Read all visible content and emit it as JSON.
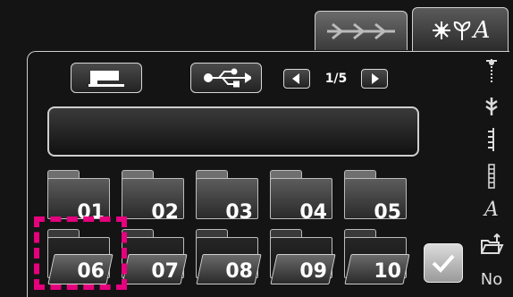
{
  "tabs": {
    "stitch_tab": {
      "icon": "decorative-stitch-icon"
    },
    "letter_tab": {
      "label": "A",
      "icons": [
        "flower-icon",
        "leaf-icon"
      ]
    }
  },
  "toolbar": {
    "machine_icon": "sewing-machine-icon",
    "usb_icon": "usb-icon",
    "page_indicator": "1/5"
  },
  "name_field": {
    "value": ""
  },
  "folders": [
    {
      "label": "01"
    },
    {
      "label": "02"
    },
    {
      "label": "03"
    },
    {
      "label": "04"
    },
    {
      "label": "05"
    },
    {
      "label": "06"
    },
    {
      "label": "07"
    },
    {
      "label": "08"
    },
    {
      "label": "09"
    },
    {
      "label": "10"
    }
  ],
  "selected_folder": "06",
  "sidebar": {
    "letter_label": "A",
    "no_label": "No"
  },
  "colors": {
    "selection": "#e6007e",
    "background": "#141414"
  }
}
